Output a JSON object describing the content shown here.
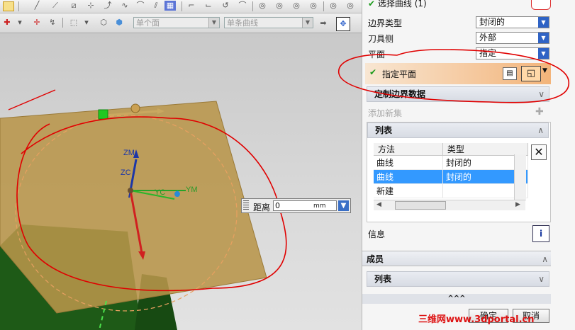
{
  "toolbar": {
    "filter_select": "单个面",
    "curve_rule_select": "单条曲线"
  },
  "viewport": {
    "axis_zm": "ZM",
    "axis_zc": "ZC",
    "axis_yc": "YC",
    "axis_ym": "YM",
    "distance_label": "距离",
    "distance_value": "0",
    "distance_unit": "mm"
  },
  "panel": {
    "select_curve_label": "选择曲线 (1)",
    "boundary_type_label": "边界类型",
    "boundary_type_value": "封闭的",
    "tool_side_label": "刀具侧",
    "tool_side_value": "外部",
    "plane_label": "平面",
    "plane_value": "指定",
    "specify_plane_label": "指定平面",
    "custom_boundary_header": "定制边界数据",
    "add_new_label": "添加新集",
    "list_header": "列表",
    "list_columns": [
      "方法",
      "类型"
    ],
    "list_rows": [
      {
        "method": "曲线",
        "type": "封闭的"
      },
      {
        "method": "曲线",
        "type": "封闭的"
      },
      {
        "method": "新建",
        "type": ""
      }
    ],
    "info_label": "信息",
    "members_header": "成员",
    "members_list_header": "列表",
    "ok_label": "确定",
    "cancel_label": "取消"
  },
  "watermark": "三维网www.3dportal.cn",
  "colors": {
    "accent_blue": "#3399ff",
    "plane_fill": "#b8954a",
    "orange_active": "#f3b47a",
    "annotation_red": "#e00000"
  }
}
